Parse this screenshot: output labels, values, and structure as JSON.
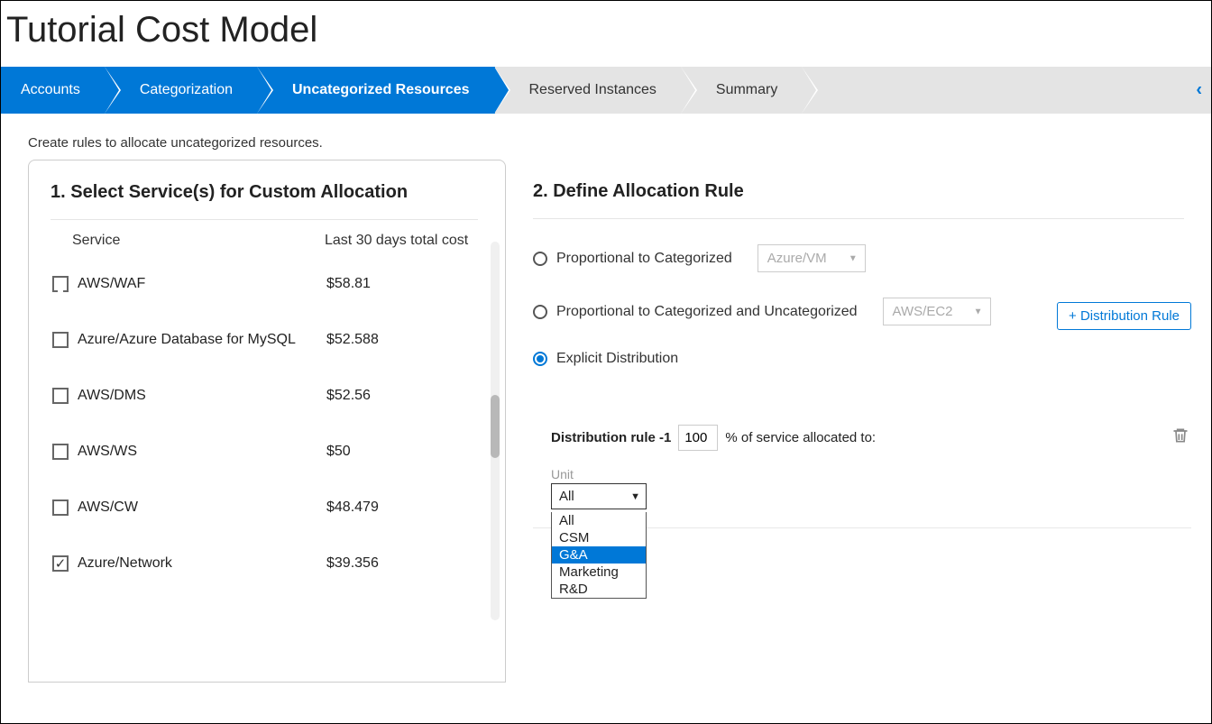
{
  "page_title": "Tutorial Cost Model",
  "wizard": {
    "steps": [
      {
        "label": "Accounts",
        "active": true
      },
      {
        "label": "Categorization",
        "active": true
      },
      {
        "label": "Uncategorized Resources",
        "active": true,
        "current": true
      },
      {
        "label": "Reserved Instances",
        "active": false
      },
      {
        "label": "Summary",
        "active": false
      }
    ],
    "collapse_glyph": "‹"
  },
  "subtitle": "Create rules to allocate uncategorized resources.",
  "select_panel": {
    "title": "1. Select Service(s) for Custom Allocation",
    "col_service": "Service",
    "col_cost": "Last 30 days total cost",
    "rows": [
      {
        "name": "AWS/WAF",
        "cost": "$58.81",
        "checked": false,
        "partial": true
      },
      {
        "name": "Azure/Azure Database for MySQL",
        "cost": "$52.588",
        "checked": false
      },
      {
        "name": "AWS/DMS",
        "cost": "$52.56",
        "checked": false
      },
      {
        "name": "AWS/WS",
        "cost": "$50",
        "checked": false
      },
      {
        "name": "AWS/CW",
        "cost": "$48.479",
        "checked": false
      },
      {
        "name": "Azure/Network",
        "cost": "$39.356",
        "checked": true
      }
    ]
  },
  "define_panel": {
    "title": "2. Define Allocation Rule",
    "opt1_label": "Proportional to Categorized",
    "opt1_select": "Azure/VM",
    "opt2_label": "Proportional to Categorized and Uncategorized",
    "opt2_select": "AWS/EC2",
    "opt3_label": "Explicit Distribution",
    "dist_button": "+ Distribution Rule",
    "rule_prefix": "Distribution rule -1",
    "rule_value": "100",
    "rule_suffix": "% of service allocated to:",
    "unit_label": "Unit",
    "unit_selected": "All",
    "unit_options": [
      "All",
      "CSM",
      "G&A",
      "Marketing",
      "R&D"
    ],
    "unit_highlight_index": 2
  }
}
